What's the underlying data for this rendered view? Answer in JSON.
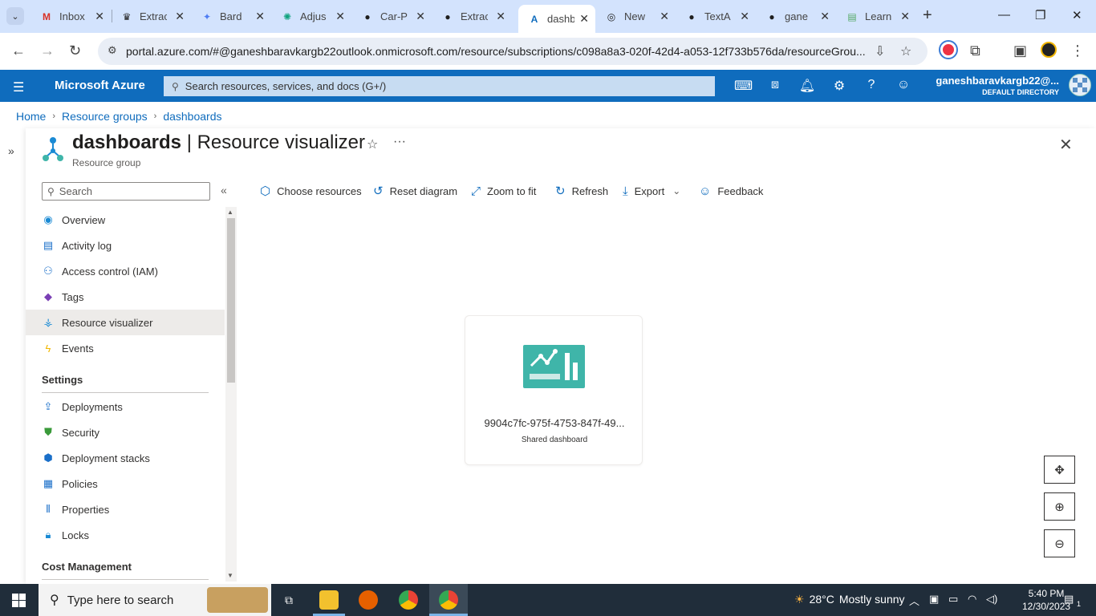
{
  "browser": {
    "tabs": [
      {
        "label": "Inbox",
        "icon": "gmail-icon",
        "color": "#d93025"
      },
      {
        "label": "Extrac",
        "icon": "crown-icon",
        "color": "#222"
      },
      {
        "label": "Bard",
        "icon": "bard-icon",
        "color": "#4f7df3"
      },
      {
        "label": "Adjus",
        "icon": "chatgpt-icon",
        "color": "#10a37f"
      },
      {
        "label": "Car-P",
        "icon": "github-icon",
        "color": "#111"
      },
      {
        "label": "Extrac",
        "icon": "github-icon",
        "color": "#111"
      },
      {
        "label": "dashb",
        "icon": "azure-icon",
        "color": "#0f6cbd"
      },
      {
        "label": "New",
        "icon": "openai-icon",
        "color": "#333"
      },
      {
        "label": "TextA",
        "icon": "github-icon",
        "color": "#111"
      },
      {
        "label": "gane",
        "icon": "github-icon",
        "color": "#111"
      },
      {
        "label": "Learn",
        "icon": "learn-icon",
        "color": "#5a6"
      }
    ],
    "url": "portal.azure.com/#@ganeshbaravkargb22outlook.onmicrosoft.com/resource/subscriptions/c098a8a3-020f-42d4-a053-12f733b576da/resourceGrou..."
  },
  "azure": {
    "brand": "Microsoft Azure",
    "search_placeholder": "Search resources, services, and docs (G+/)",
    "user_name": "ganeshbaravkargb22@...",
    "user_directory": "DEFAULT DIRECTORY"
  },
  "breadcrumb": [
    "Home",
    "Resource groups",
    "dashboards"
  ],
  "blade": {
    "title_bold": "dashboards",
    "title_rest": " | Resource visualizer",
    "subtitle": "Resource group"
  },
  "menu": {
    "search_placeholder": "Search",
    "items": [
      {
        "label": "Overview",
        "icon": "overview-icon"
      },
      {
        "label": "Activity log",
        "icon": "activity-log-icon"
      },
      {
        "label": "Access control (IAM)",
        "icon": "iam-icon"
      },
      {
        "label": "Tags",
        "icon": "tag-icon"
      },
      {
        "label": "Resource visualizer",
        "icon": "visualizer-icon",
        "selected": true
      },
      {
        "label": "Events",
        "icon": "lightning-icon"
      }
    ],
    "settings_title": "Settings",
    "settings_items": [
      {
        "label": "Deployments",
        "icon": "deploy-icon"
      },
      {
        "label": "Security",
        "icon": "shield-icon"
      },
      {
        "label": "Deployment stacks",
        "icon": "stack-icon"
      },
      {
        "label": "Policies",
        "icon": "policy-icon"
      },
      {
        "label": "Properties",
        "icon": "properties-icon"
      },
      {
        "label": "Locks",
        "icon": "lock-icon"
      }
    ],
    "cost_title": "Cost Management"
  },
  "toolbar": {
    "choose": "Choose resources",
    "reset": "Reset diagram",
    "zoom_fit": "Zoom to fit",
    "refresh": "Refresh",
    "export": "Export",
    "feedback": "Feedback"
  },
  "diagram": {
    "resource_name": "9904c7fc-975f-4753-847f-49...",
    "resource_type": "Shared dashboard"
  },
  "taskbar": {
    "search_placeholder": "Type here to search",
    "weather_temp": "28°C",
    "weather_text": "Mostly sunny",
    "time": "5:40 PM",
    "date": "12/30/2023",
    "notifications": "1"
  },
  "colors": {
    "azure_blue": "#0f6cbd",
    "tab_strip": "#d3e3fd",
    "dashboard_icon": "#3fb5a9",
    "taskbar": "#202d3a"
  }
}
